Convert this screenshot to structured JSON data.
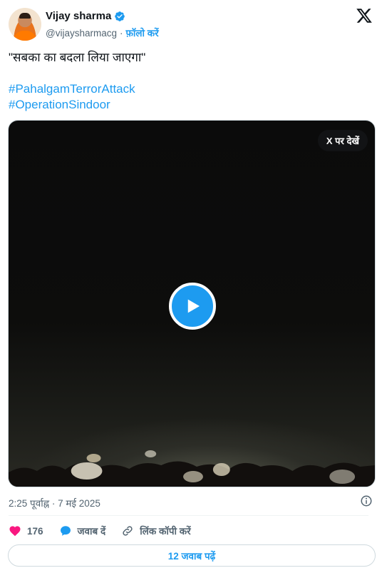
{
  "author": {
    "name": "Vijay sharma",
    "handle": "@vijaysharmacg",
    "separator": "·",
    "follow_label": "फ़ॉलो करें",
    "verified": true
  },
  "tweet": {
    "text": "\"सबका का बदला लिया जाएगा\"",
    "hashtags": [
      "#PahalgamTerrorAttack",
      "#OperationSindoor"
    ]
  },
  "media": {
    "view_on_x_label": "X पर देखें",
    "type": "video"
  },
  "meta": {
    "timestamp": "2:25 पूर्वाह्न · 7 मई 2025"
  },
  "actions": {
    "like_count": "176",
    "reply_label": "जवाब दें",
    "copy_link_label": "लिंक कॉपी करें"
  },
  "footer": {
    "read_replies_label": "12 जवाब पढ़ें"
  },
  "colors": {
    "accent": "#1d9bf0",
    "like": "#f91880",
    "muted": "#536471"
  }
}
